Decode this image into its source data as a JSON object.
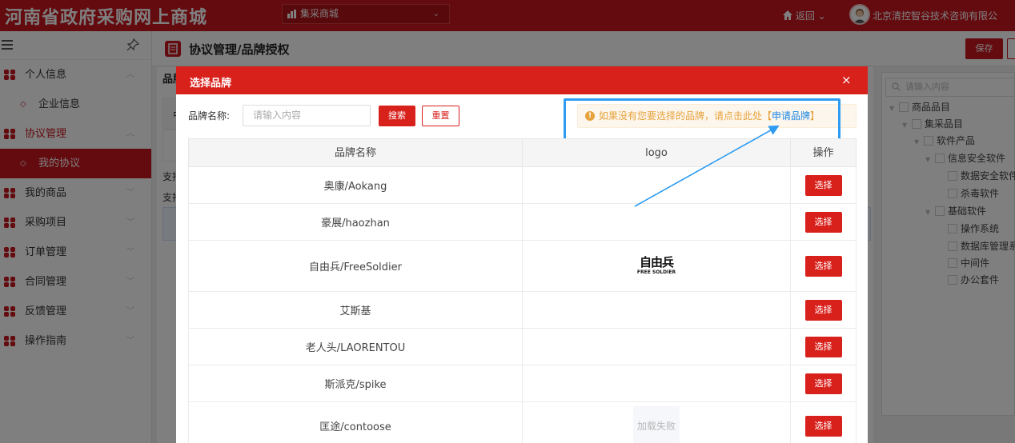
{
  "topbar": {
    "site_title": "河南省政府采购网上商城",
    "mall_select": "集采商城",
    "back": "返回",
    "company": "北京清控智谷技术咨询有限公"
  },
  "sidebar": {
    "items": [
      {
        "label": "个人信息"
      },
      {
        "label": "企业信息"
      },
      {
        "label": "协议管理"
      },
      {
        "label": "我的协议"
      },
      {
        "label": "我的商品"
      },
      {
        "label": "采购项目"
      },
      {
        "label": "订单管理"
      },
      {
        "label": "合同管理"
      },
      {
        "label": "反馈管理"
      },
      {
        "label": "操作指南"
      }
    ]
  },
  "main": {
    "title": "协议管理/品牌授权",
    "save": "保存",
    "bg_brand": "品牌",
    "bg_cell": "中",
    "bg_text1": "支持",
    "bg_text2": "支持"
  },
  "tree": {
    "placeholder": "请输入内容",
    "nodes": [
      "商品品目",
      "集采品目",
      "软件产品",
      "信息安全软件",
      "数据安全软件",
      "杀毒软件",
      "基础软件",
      "操作系统",
      "数据库管理系",
      "中间件",
      "办公套件"
    ]
  },
  "modal": {
    "title": "选择品牌",
    "close": "×",
    "search_label": "品牌名称:",
    "search_placeholder": "请输入内容",
    "search_btn": "搜索",
    "reset_btn": "重置",
    "notice_text": "如果没有您要选择的品牌，请点击此处【",
    "notice_link": "申请品牌",
    "notice_end": "】",
    "columns": [
      "品牌名称",
      "logo",
      "操作"
    ],
    "rows": [
      {
        "name": "奥康/Aokang",
        "logo": "",
        "action": "选择"
      },
      {
        "name": "豪展/haozhan",
        "logo": "",
        "action": "选择"
      },
      {
        "name": "自由兵/FreeSoldier",
        "logo": "自由兵",
        "logo_sub": "FREE SOLDIER",
        "action": "选择"
      },
      {
        "name": "艾斯基",
        "logo": "",
        "action": "选择"
      },
      {
        "name": "老人头/LAORENTOU",
        "logo": "",
        "action": "选择"
      },
      {
        "name": "斯派克/spike",
        "logo": "",
        "action": "选择"
      },
      {
        "name": "匡途/contoose",
        "logo": "加载失败",
        "action": "选择"
      }
    ]
  },
  "colors": {
    "brand_red": "#c6161e",
    "modal_red": "#d9211c",
    "highlight_blue": "#2e9cf2",
    "warning": "#e6a23c"
  }
}
